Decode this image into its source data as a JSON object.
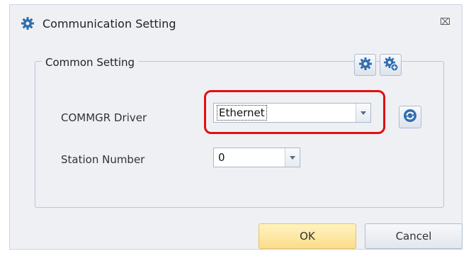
{
  "window": {
    "title": "Communication Setting",
    "title_icon": "gear-icon",
    "close_glyph": "⌧"
  },
  "group": {
    "legend": "Common Setting",
    "toolbar_icons": [
      "gear-icon",
      "gear-add-icon"
    ]
  },
  "fields": {
    "driver_label": "COMMGR Driver",
    "driver_value": "Ethernet",
    "station_label": "Station Number",
    "station_value": "0",
    "refresh_icon": "refresh-icon"
  },
  "buttons": {
    "ok": "OK",
    "cancel": "Cancel"
  },
  "colors": {
    "highlight": "#e11010",
    "ok_button": "#fbdd8a",
    "dialog_bg": "#eef0f4",
    "icon_blue": "#2f6fb0"
  }
}
